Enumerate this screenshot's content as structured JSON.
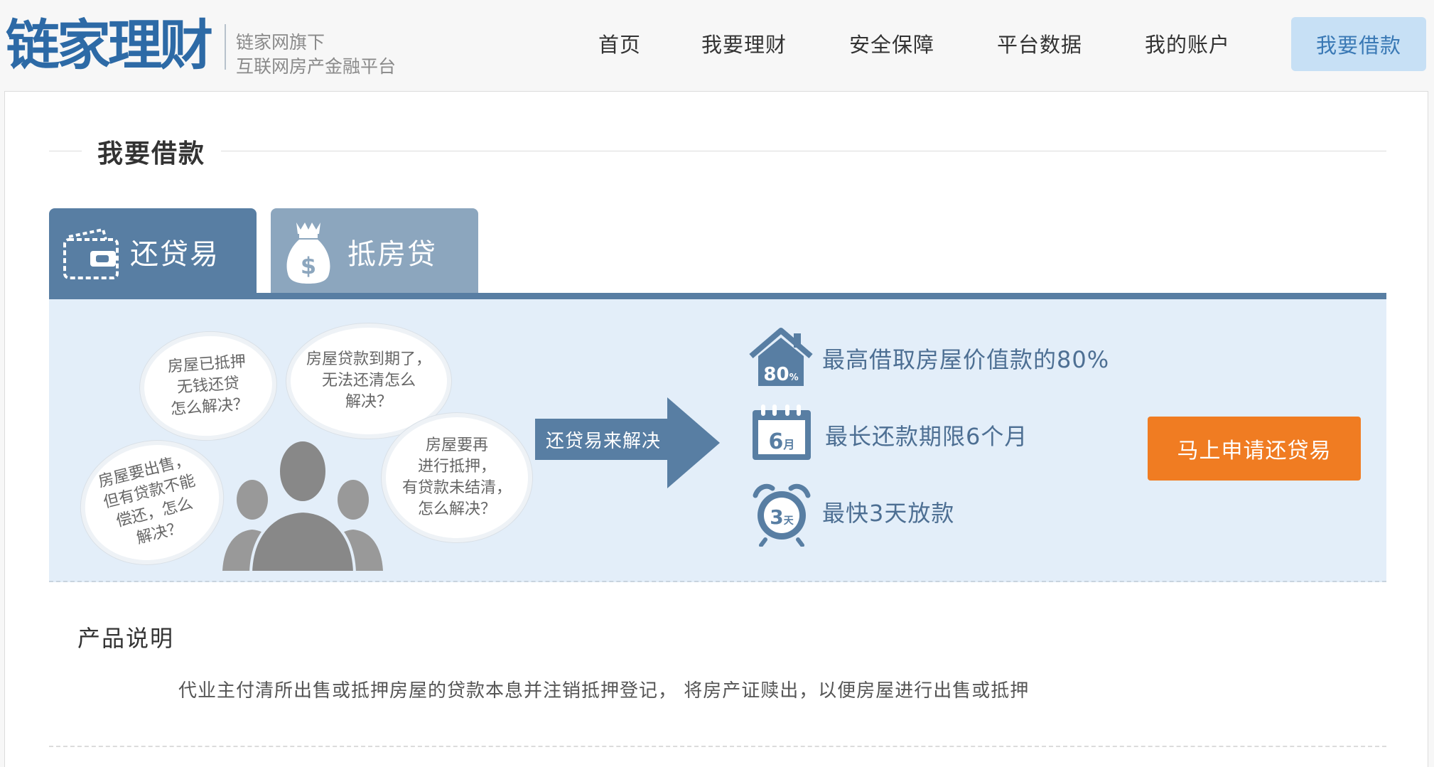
{
  "logo": {
    "main": "链家理财",
    "sub_line1": "链家网旗下",
    "sub_line2": "互联网房产金融平台"
  },
  "nav": {
    "items": [
      "首页",
      "我要理财",
      "安全保障",
      "平台数据",
      "我的账户"
    ],
    "cta": "我要借款"
  },
  "page": {
    "section_title": "我要借款"
  },
  "tabs": [
    {
      "label": "还贷易",
      "icon": "wallet-icon",
      "active": true
    },
    {
      "label": "抵房贷",
      "icon": "money-bag-icon",
      "active": false
    }
  ],
  "banner": {
    "bubbles": [
      "房屋已抵押\n无钱还贷\n怎么解决？",
      "房屋贷款到期了，\n无法还清怎么\n解决？",
      "房屋要出售，\n但有贷款不能\n偿还，怎么\n解决？",
      "房屋要再\n进行抵押，\n有贷款未结清，\n怎么解决？"
    ],
    "arrow_label": "还贷易来解决",
    "features": [
      {
        "icon": "house-80-icon",
        "badge": "80%",
        "text": "最高借取房屋价值款的80%"
      },
      {
        "icon": "calendar-6-icon",
        "badge": "6月",
        "text": "最长还款期限6个月"
      },
      {
        "icon": "alarm-clock-3-icon",
        "badge": "3天",
        "text": "最快3天放款"
      }
    ],
    "apply_button": "马上申请还贷易"
  },
  "product": {
    "title": "产品说明",
    "description": "代业主付清所出售或抵押房屋的贷款本息并注销抵押登记， 将房产证赎出，以便房屋进行出售或抵押"
  },
  "colors": {
    "brand_blue": "#2d6aa6",
    "tab_active": "#587ea3",
    "tab_inactive": "#8ca6be",
    "banner_bg": "#e3eef9",
    "cta_orange": "#f07c22",
    "nav_cta_bg": "#c7e0f5"
  }
}
